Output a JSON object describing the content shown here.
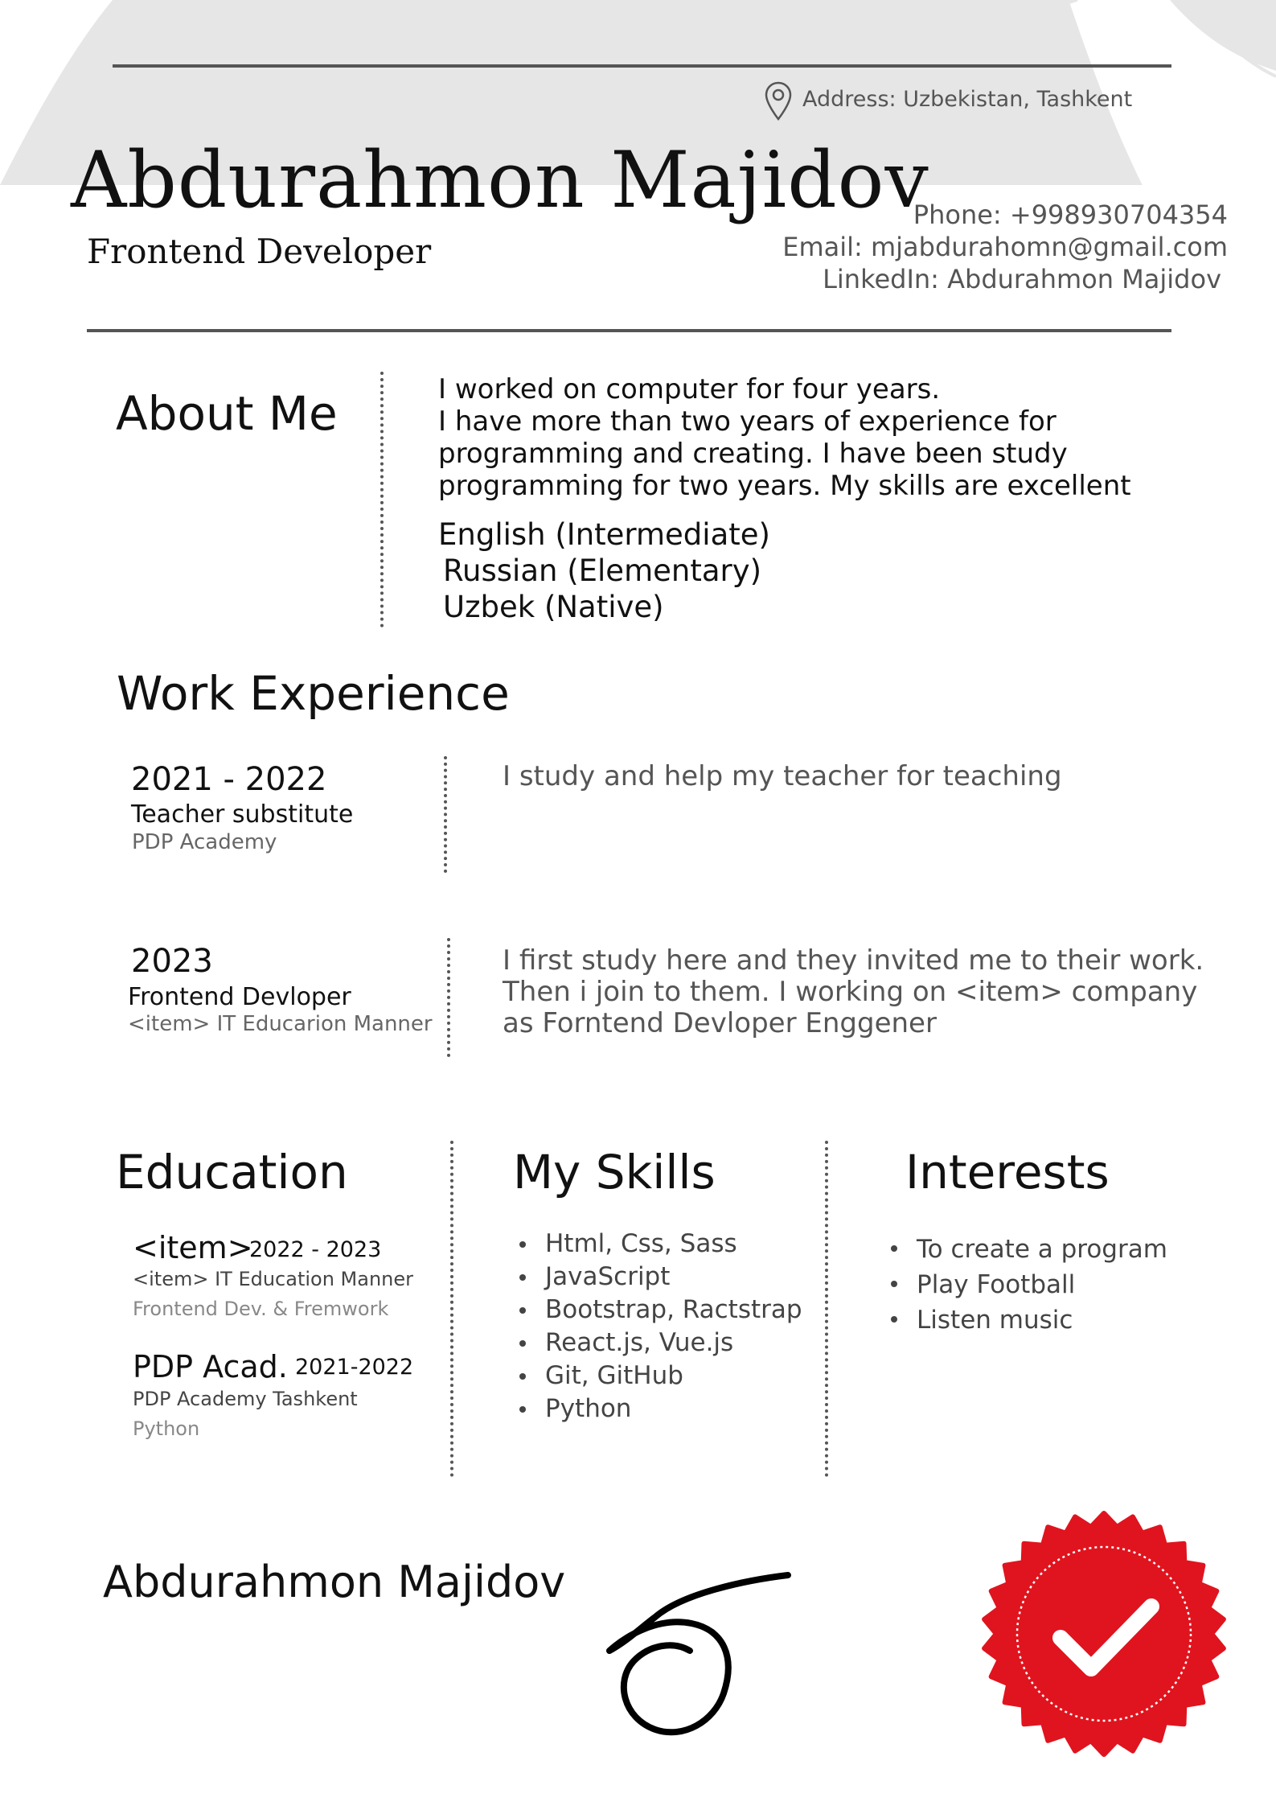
{
  "header": {
    "name": "Abdurahmon Majidov",
    "role": "Frontend Developer",
    "address": "Address: Uzbekistan, Tashkent",
    "phone": "Phone: +998930704354",
    "email": "Email: mjabdurahomn@gmail.com",
    "linkedin": "LinkedIn:  Abdurahmon Majidov"
  },
  "about": {
    "title": "About Me",
    "lines": [
      "I worked on computer  for four years.",
      "I have more than two years of experience for",
      "programming and creating. I have been study",
      "programming for two years. My skills  are excellent"
    ],
    "languages": [
      "English (Intermediate)",
      "Russian (Elementary)",
      "Uzbek (Native)"
    ]
  },
  "work": {
    "title": "Work Experience",
    "items": [
      {
        "year": "2021 - 2022",
        "role": "Teacher substitute",
        "org": "PDP Academy",
        "lines": [
          "I study and help my teacher for teaching"
        ]
      },
      {
        "year": "2023",
        "role": "Frontend Devloper",
        "org": "<item> IT Educarion Manner",
        "lines": [
          "I first study here and they invited me to their work.",
          "Then i join to them. I working on <item> company",
          "as Forntend Devloper Enggener"
        ]
      }
    ]
  },
  "education": {
    "title": "Education",
    "items": [
      {
        "name": "<item>",
        "years": "2022 - 2023",
        "school": "<item> IT Education Manner",
        "field": "Frontend Dev. & Fremwork"
      },
      {
        "name": "PDP Acad.",
        "years": "2021-2022",
        "school": "PDP Academy Tashkent",
        "field": "Python"
      }
    ]
  },
  "skills": {
    "title": "My Skills",
    "items": [
      "Html, Css, Sass",
      "JavaScript",
      "Bootstrap, Ractstrap",
      "React.js, Vue.js",
      "Git, GitHub",
      "Python"
    ]
  },
  "interests": {
    "title": "Interests",
    "items": [
      "To create a program",
      "Play Football",
      "Listen music"
    ]
  },
  "footer": {
    "name": "Abdurahmon Majidov"
  },
  "icons": {
    "location": "location-pin-icon",
    "seal": "checkmark-seal-icon",
    "signature": "signature"
  },
  "colors": {
    "header_band": "#e6e6e6",
    "rule": "#555555",
    "seal_red": "#e0141e",
    "text_dark": "#111111",
    "text_gray": "#555555"
  }
}
